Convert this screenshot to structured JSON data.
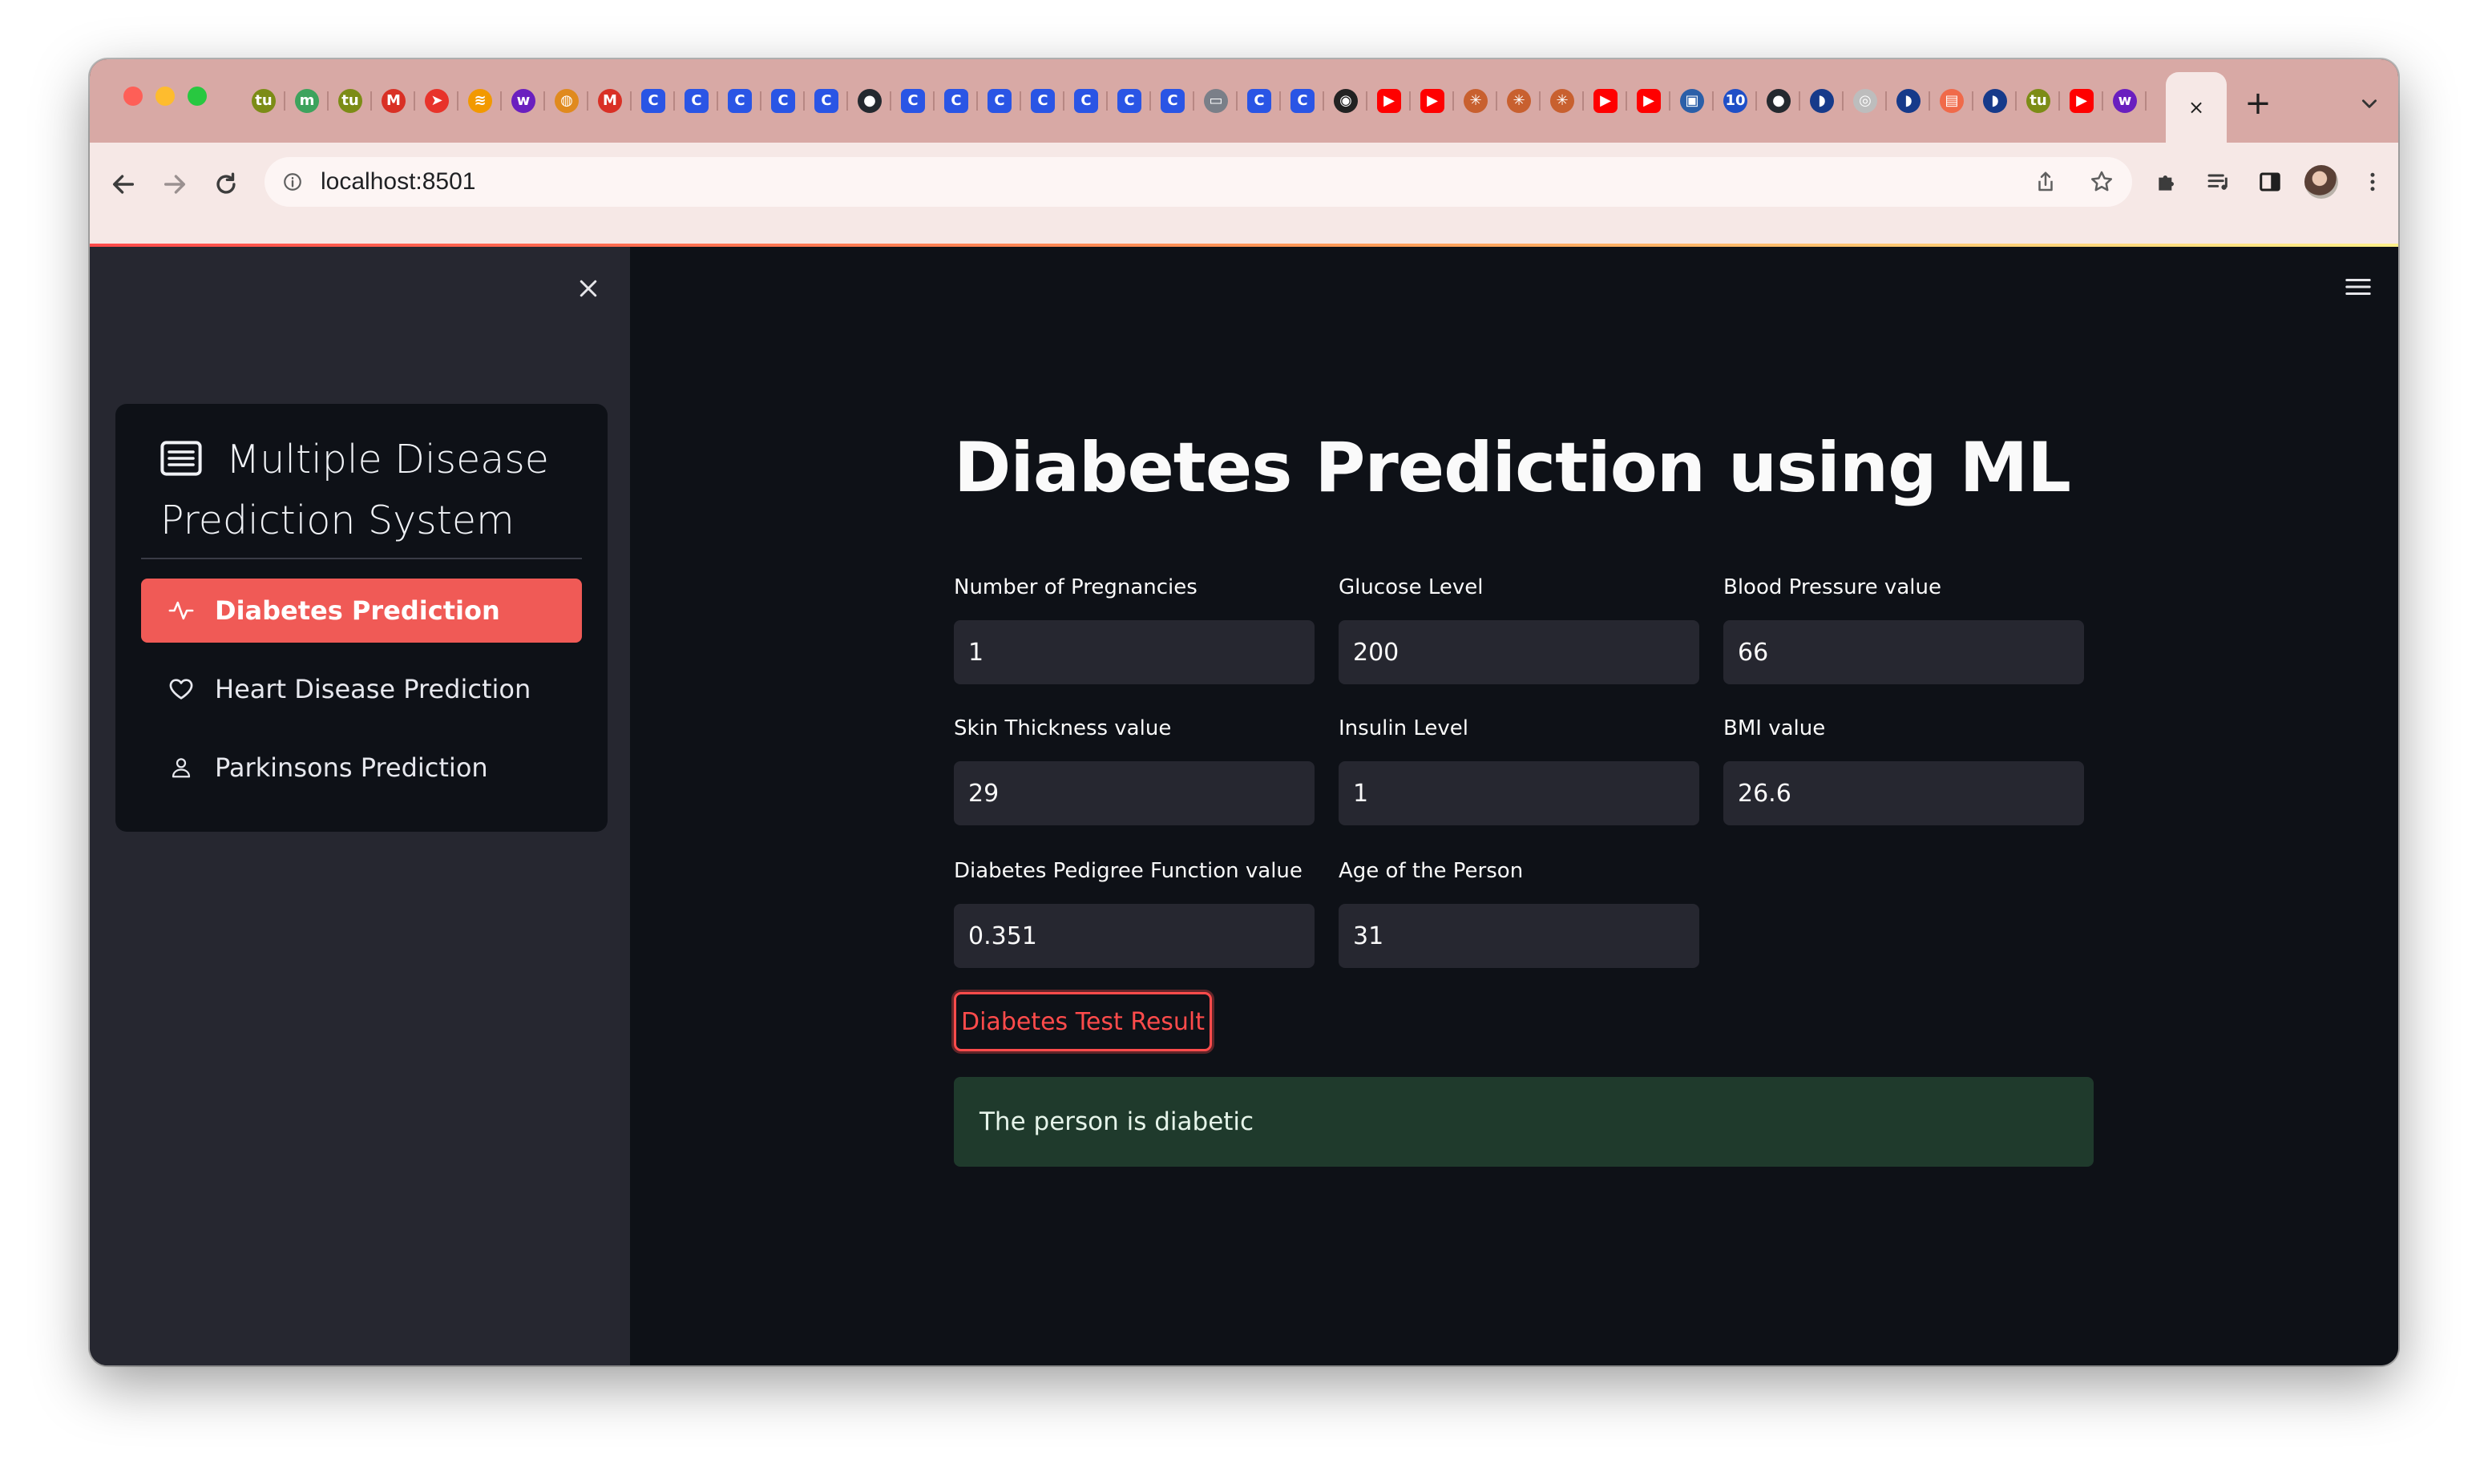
{
  "browser": {
    "url": "localhost:8501",
    "tab_favicons": [
      {
        "icon": "tutorial-site-icon",
        "glyph": "tu",
        "color": "#7c8c16"
      },
      {
        "icon": "m-site-icon",
        "glyph": "m",
        "color": "#3da35d"
      },
      {
        "icon": "tutorial-site-icon",
        "glyph": "tu",
        "color": "#7c8c16"
      },
      {
        "icon": "gmail-icon",
        "glyph": "M",
        "color": "#d93025"
      },
      {
        "icon": "arrow-site-icon",
        "glyph": "➤",
        "color": "#e8332a"
      },
      {
        "icon": "rss-site-icon",
        "glyph": "≋",
        "color": "#f29900"
      },
      {
        "icon": "w-site-icon",
        "glyph": "w",
        "color": "#6a1fbf"
      },
      {
        "icon": "globe-site-icon",
        "glyph": "◍",
        "color": "#e08a1e"
      },
      {
        "icon": "gmail-icon",
        "glyph": "M",
        "color": "#d93025"
      },
      {
        "icon": "coursera-icon",
        "glyph": "C",
        "color": "#2a55e5"
      },
      {
        "icon": "coursera-icon",
        "glyph": "C",
        "color": "#2a55e5"
      },
      {
        "icon": "coursera-icon",
        "glyph": "C",
        "color": "#2a55e5"
      },
      {
        "icon": "coursera-icon",
        "glyph": "C",
        "color": "#2a55e5"
      },
      {
        "icon": "coursera-icon",
        "glyph": "C",
        "color": "#2a55e5"
      },
      {
        "icon": "github-icon",
        "glyph": "●",
        "color": "#24292f"
      },
      {
        "icon": "coursera-icon",
        "glyph": "C",
        "color": "#2a55e5"
      },
      {
        "icon": "coursera-icon",
        "glyph": "C",
        "color": "#2a55e5"
      },
      {
        "icon": "coursera-icon",
        "glyph": "C",
        "color": "#2a55e5"
      },
      {
        "icon": "coursera-icon",
        "glyph": "C",
        "color": "#2a55e5"
      },
      {
        "icon": "coursera-icon",
        "glyph": "C",
        "color": "#2a55e5"
      },
      {
        "icon": "coursera-icon",
        "glyph": "C",
        "color": "#2a55e5"
      },
      {
        "icon": "coursera-icon",
        "glyph": "C",
        "color": "#2a55e5"
      },
      {
        "icon": "image-site-icon",
        "glyph": "▭",
        "color": "#7a7f88"
      },
      {
        "icon": "coursera-icon",
        "glyph": "C",
        "color": "#2a55e5"
      },
      {
        "icon": "coursera-icon",
        "glyph": "C",
        "color": "#2a55e5"
      },
      {
        "icon": "compass-site-icon",
        "glyph": "◉",
        "color": "#222222"
      },
      {
        "icon": "youtube-icon",
        "glyph": "▶",
        "color": "#ff0000"
      },
      {
        "icon": "youtube-icon",
        "glyph": "▶",
        "color": "#ff0000"
      },
      {
        "icon": "asterisk-site-icon",
        "glyph": "✳",
        "color": "#c8602f"
      },
      {
        "icon": "asterisk-site-icon",
        "glyph": "✳",
        "color": "#c8602f"
      },
      {
        "icon": "asterisk-site-icon",
        "glyph": "✳",
        "color": "#c8602f"
      },
      {
        "icon": "youtube-icon",
        "glyph": "▶",
        "color": "#ff0000"
      },
      {
        "icon": "youtube-icon",
        "glyph": "▶",
        "color": "#ff0000"
      },
      {
        "icon": "photo-site-icon",
        "glyph": "▣",
        "color": "#2b5fa8"
      },
      {
        "icon": "hundred-site-icon",
        "glyph": "10",
        "color": "#1f4fc7"
      },
      {
        "icon": "github-icon",
        "glyph": "●",
        "color": "#24292f"
      },
      {
        "icon": "hat-site-icon",
        "glyph": "◗",
        "color": "#163a8a"
      },
      {
        "icon": "big-site-icon",
        "glyph": "◎",
        "color": "#bdbdbd"
      },
      {
        "icon": "hat-site-icon",
        "glyph": "◗",
        "color": "#163a8a"
      },
      {
        "icon": "pdf-site-icon",
        "glyph": "▤",
        "color": "#f06a4a"
      },
      {
        "icon": "hat-site-icon",
        "glyph": "◗",
        "color": "#163a8a"
      },
      {
        "icon": "tutorial-site-icon",
        "glyph": "tu",
        "color": "#7c8c16"
      },
      {
        "icon": "youtube-icon",
        "glyph": "▶",
        "color": "#ff0000"
      },
      {
        "icon": "w-site-icon",
        "glyph": "w",
        "color": "#6a1fbf"
      }
    ],
    "active_tab_close_glyph": "×",
    "new_tab_glyph": "+"
  },
  "sidebar": {
    "menu_title": "Multiple Disease Prediction System",
    "items": [
      {
        "label": "Diabetes Prediction",
        "icon": "activity-icon",
        "active": true
      },
      {
        "label": "Heart Disease Prediction",
        "icon": "heart-icon",
        "active": false
      },
      {
        "label": "Parkinsons Prediction",
        "icon": "person-icon",
        "active": false
      }
    ]
  },
  "main": {
    "title": "Diabetes Prediction using ML",
    "fields": [
      {
        "label": "Number of Pregnancies",
        "value": "1"
      },
      {
        "label": "Glucose Level",
        "value": "200"
      },
      {
        "label": "Blood Pressure value",
        "value": "66"
      },
      {
        "label": "Skin Thickness value",
        "value": "29"
      },
      {
        "label": "Insulin Level",
        "value": "1"
      },
      {
        "label": "BMI value",
        "value": "26.6"
      },
      {
        "label": "Diabetes Pedigree Function value",
        "value": "0.351"
      },
      {
        "label": "Age of the Person",
        "value": "31"
      }
    ],
    "button_label": "Diabetes Test Result",
    "result_text": "The person is diabetic"
  },
  "colors": {
    "accent": "#ff4b4b",
    "sidebar_active": "#f05a56",
    "success_bg": "#1f3a2c",
    "app_bg": "#0e1117",
    "sidebar_bg": "#262730"
  }
}
